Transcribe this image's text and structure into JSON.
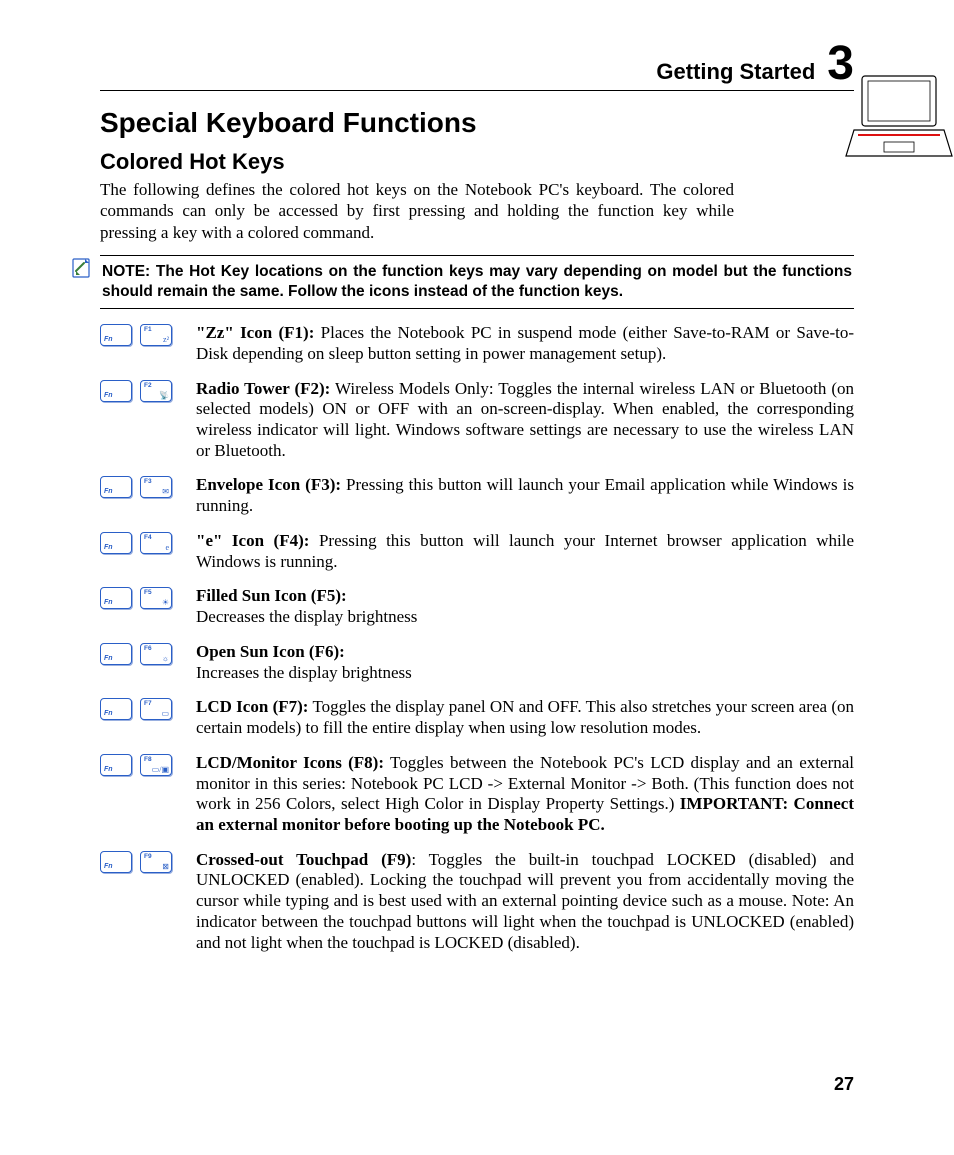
{
  "header": {
    "chapter_title": "Getting Started",
    "chapter_number": "3"
  },
  "section_title": "Special Keyboard Functions",
  "subsection_title": "Colored Hot Keys",
  "intro_text": "The following defines the colored hot keys on the Notebook PC's keyboard. The colored commands can only be accessed by first pressing and holding the function key while pressing a key with a colored command.",
  "note_text": "NOTE: The Hot Key locations on the function keys may vary depending on model but the functions should remain the same. Follow the icons instead of the function keys.",
  "fn_label": "Fn",
  "items": [
    {
      "fkey": "F1",
      "glyph": "z²",
      "title": "\"Zz\" Icon (F1):",
      "body": " Places the Notebook PC in suspend mode (either Save-to-RAM or Save-to-Disk depending on sleep button setting in power management setup)."
    },
    {
      "fkey": "F2",
      "glyph": "📡",
      "title": "Radio Tower (F2):",
      "body": " Wireless Models Only: Toggles the internal wireless LAN or Bluetooth (on selected models) ON or OFF with an on-screen-display. When enabled, the corresponding wireless indicator will light. Windows software settings are necessary to use the wireless LAN or Bluetooth."
    },
    {
      "fkey": "F3",
      "glyph": "✉",
      "title": "Envelope Icon (F3):",
      "body": " Pressing this button will launch your Email application while Windows is running."
    },
    {
      "fkey": "F4",
      "glyph": "e",
      "title": "\"e\" Icon (F4):",
      "body": " Pressing this button will launch your Internet browser application while Windows is running."
    },
    {
      "fkey": "F5",
      "glyph": "☀",
      "title": "Filled Sun Icon (F5):",
      "body": "<br>Decreases the display brightness"
    },
    {
      "fkey": "F6",
      "glyph": "☼",
      "title": "Open Sun Icon (F6):",
      "body": "<br>Increases the display brightness"
    },
    {
      "fkey": "F7",
      "glyph": "▭",
      "title": "LCD Icon (F7):",
      "body": " Toggles the display panel ON and OFF. This also stretches your screen area (on certain models) to fill the entire display when using low resolution modes."
    },
    {
      "fkey": "F8",
      "glyph": "▭/▣",
      "title": "LCD/Monitor Icons (F8):",
      "body": " Toggles between the Notebook PC's LCD display and an external monitor in this series: Notebook PC LCD -> External Monitor -> Both. (This function does not work in 256 Colors, select High Color in Display Property Settings.) <b>IMPORTANT: Connect an external monitor before booting up the Notebook PC.</b>"
    },
    {
      "fkey": "F9",
      "glyph": "⊠",
      "title": "Crossed-out Touchpad (F9)",
      "body": ": Toggles the built-in touchpad LOCKED (disabled) and UNLOCKED (enabled). Locking the touchpad will prevent you from accidentally moving the cursor while typing and is best used with an external pointing device such as a mouse. Note: An indicator between the touchpad buttons will light when the touchpad is UNLOCKED (enabled) and not light when the touchpad is LOCKED (disabled)."
    }
  ],
  "page_number": "27"
}
